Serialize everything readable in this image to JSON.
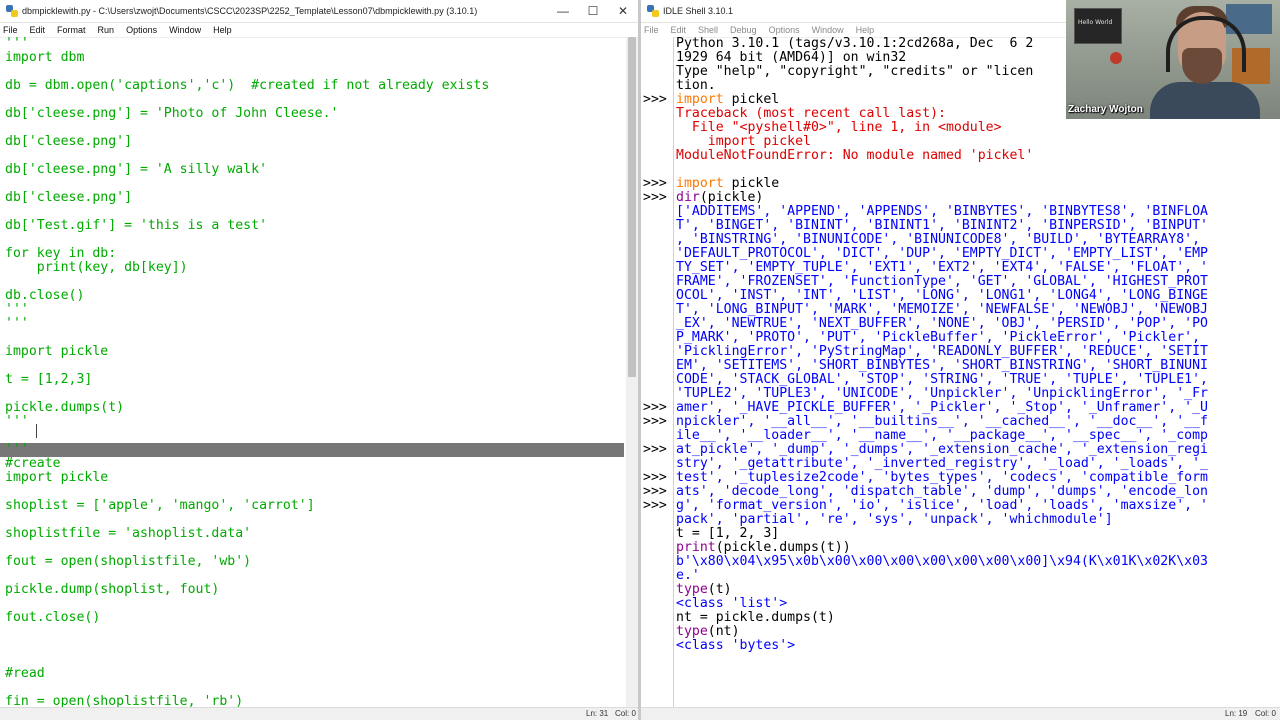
{
  "editor": {
    "title": "dbmpicklewith.py - C:\\Users\\zwojt\\Documents\\CSCC\\2023SP\\2252_Template\\Lesson07\\dbmpicklewith.py (3.10.1)",
    "menu": [
      "File",
      "Edit",
      "Format",
      "Run",
      "Options",
      "Window",
      "Help"
    ],
    "lines": [
      {
        "t": "'''",
        "c": "string"
      },
      {
        "t": "import dbm",
        "c": "string"
      },
      {
        "t": "",
        "c": "string"
      },
      {
        "t": "db = dbm.open('captions','c')  #created if not already exists",
        "c": "string"
      },
      {
        "t": "",
        "c": "string"
      },
      {
        "t": "db['cleese.png'] = 'Photo of John Cleese.'",
        "c": "string"
      },
      {
        "t": "",
        "c": "string"
      },
      {
        "t": "db['cleese.png']",
        "c": "string"
      },
      {
        "t": "",
        "c": "string"
      },
      {
        "t": "db['cleese.png'] = 'A silly walk'",
        "c": "string"
      },
      {
        "t": "",
        "c": "string"
      },
      {
        "t": "db['cleese.png']",
        "c": "string"
      },
      {
        "t": "",
        "c": "string"
      },
      {
        "t": "db['Test.gif'] = 'this is a test'",
        "c": "string"
      },
      {
        "t": "",
        "c": "string"
      },
      {
        "t": "for key in db:",
        "c": "string"
      },
      {
        "t": "    print(key, db[key])",
        "c": "string"
      },
      {
        "t": "",
        "c": "string"
      },
      {
        "t": "db.close()",
        "c": "string"
      },
      {
        "t": "'''",
        "c": "string"
      },
      {
        "t": "'''",
        "c": "string"
      },
      {
        "t": "",
        "c": "string"
      },
      {
        "t": "import pickle",
        "c": "string"
      },
      {
        "t": "",
        "c": "string"
      },
      {
        "t": "t = [1,2,3]",
        "c": "string"
      },
      {
        "t": "",
        "c": "string"
      },
      {
        "t": "pickle.dumps(t)",
        "c": "string"
      },
      {
        "t": "'''",
        "c": "string"
      },
      {
        "t": "",
        "c": "string"
      },
      {
        "t": "'''",
        "c": "string",
        "sel": true
      },
      {
        "t": "#create",
        "c": "string"
      },
      {
        "t": "import pickle",
        "c": "string"
      },
      {
        "t": "",
        "c": "string"
      },
      {
        "t": "shoplist = ['apple', 'mango', 'carrot']",
        "c": "string"
      },
      {
        "t": "",
        "c": "string"
      },
      {
        "t": "shoplistfile = 'ashoplist.data'",
        "c": "string"
      },
      {
        "t": "",
        "c": "string"
      },
      {
        "t": "fout = open(shoplistfile, 'wb')",
        "c": "string"
      },
      {
        "t": "",
        "c": "string"
      },
      {
        "t": "pickle.dump(shoplist, fout)",
        "c": "string"
      },
      {
        "t": "",
        "c": "string"
      },
      {
        "t": "fout.close()",
        "c": "string"
      },
      {
        "t": "",
        "c": "string"
      },
      {
        "t": "",
        "c": "string"
      },
      {
        "t": "",
        "c": "string"
      },
      {
        "t": "#read",
        "c": "string"
      },
      {
        "t": "",
        "c": "string"
      },
      {
        "t": "fin = open(shoplistfile, 'rb')",
        "c": "string"
      }
    ],
    "status_line": "Ln: 31",
    "status_col": "Col: 0"
  },
  "shell": {
    "title": "IDLE Shell 3.10.1",
    "menu": [
      "File",
      "Edit",
      "Shell",
      "Debug",
      "Options",
      "Window",
      "Help"
    ],
    "prompt": ">>>",
    "prompt_rows": [
      4,
      10,
      11,
      26,
      27,
      29,
      31,
      32,
      33
    ],
    "lines": [
      {
        "t": "Python 3.10.1 (tags/v3.10.1:2cd268a, Dec  6 2",
        "c": "normal"
      },
      {
        "t": "1929 64 bit (AMD64)] on win32",
        "c": "normal"
      },
      {
        "t": "Type \"help\", \"copyright\", \"credits\" or \"licen",
        "c": "normal"
      },
      {
        "t": "tion.",
        "c": "normal"
      },
      {
        "t": "import pickel",
        "c": "normal",
        "kw": "import"
      },
      {
        "t": "Traceback (most recent call last):",
        "c": "error"
      },
      {
        "t": "  File \"<pyshell#0>\", line 1, in <module>",
        "c": "error"
      },
      {
        "t": "    import pickel",
        "c": "error"
      },
      {
        "t": "ModuleNotFoundError: No module named 'pickel'",
        "c": "error"
      },
      {
        "t": "",
        "c": "normal"
      },
      {
        "t": "import pickle",
        "c": "normal",
        "kw": "import"
      },
      {
        "t": "dir(pickle)",
        "c": "normal",
        "bi": "dir"
      },
      {
        "t": "['ADDITEMS', 'APPEND', 'APPENDS', 'BINBYTES', 'BINBYTES8', 'BINFLOA",
        "c": "output"
      },
      {
        "t": "T', 'BINGET', 'BININT', 'BININT1', 'BININT2', 'BINPERSID', 'BINPUT'",
        "c": "output"
      },
      {
        "t": ", 'BINSTRING', 'BINUNICODE', 'BINUNICODE8', 'BUILD', 'BYTEARRAY8',",
        "c": "output"
      },
      {
        "t": "'DEFAULT_PROTOCOL', 'DICT', 'DUP', 'EMPTY_DICT', 'EMPTY_LIST', 'EMP",
        "c": "output"
      },
      {
        "t": "TY_SET', 'EMPTY_TUPLE', 'EXT1', 'EXT2', 'EXT4', 'FALSE', 'FLOAT', '",
        "c": "output"
      },
      {
        "t": "FRAME', 'FROZENSET', 'FunctionType', 'GET', 'GLOBAL', 'HIGHEST_PROT",
        "c": "output"
      },
      {
        "t": "OCOL', 'INST', 'INT', 'LIST', 'LONG', 'LONG1', 'LONG4', 'LONG_BINGE",
        "c": "output"
      },
      {
        "t": "T', 'LONG_BINPUT', 'MARK', 'MEMOIZE', 'NEWFALSE', 'NEWOBJ', 'NEWOBJ",
        "c": "output"
      },
      {
        "t": "_EX', 'NEWTRUE', 'NEXT_BUFFER', 'NONE', 'OBJ', 'PERSID', 'POP', 'PO",
        "c": "output"
      },
      {
        "t": "P_MARK', 'PROTO', 'PUT', 'PickleBuffer', 'PickleError', 'Pickler',",
        "c": "output"
      },
      {
        "t": "'PicklingError', 'PyStringMap', 'READONLY_BUFFER', 'REDUCE', 'SETIT",
        "c": "output"
      },
      {
        "t": "EM', 'SETITEMS', 'SHORT_BINBYTES', 'SHORT_BINSTRING', 'SHORT_BINUNI",
        "c": "output"
      },
      {
        "t": "CODE', 'STACK_GLOBAL', 'STOP', 'STRING', 'TRUE', 'TUPLE', 'TUPLE1',",
        "c": "output"
      },
      {
        "t": "'TUPLE2', 'TUPLE3', 'UNICODE', 'Unpickler', 'UnpicklingError', '_Fr",
        "c": "output"
      },
      {
        "t": "amer', '_HAVE_PICKLE_BUFFER', '_Pickler', '_Stop', '_Unframer', '_U",
        "c": "output"
      },
      {
        "t": "npickler', '__all__', '__builtins__', '__cached__', '__doc__', '__f",
        "c": "output"
      },
      {
        "t": "ile__', '__loader__', '__name__', '__package__', '__spec__', '_comp",
        "c": "output"
      },
      {
        "t": "at_pickle', '_dump', '_dumps', '_extension_cache', '_extension_regi",
        "c": "output"
      },
      {
        "t": "stry', '_getattribute', '_inverted_registry', '_load', '_loads', '_",
        "c": "output"
      },
      {
        "t": "test', '_tuplesize2code', 'bytes_types', 'codecs', 'compatible_form",
        "c": "output"
      },
      {
        "t": "ats', 'decode_long', 'dispatch_table', 'dump', 'dumps', 'encode_lon",
        "c": "output"
      },
      {
        "t": "g', 'format_version', 'io', 'islice', 'load', 'loads', 'maxsize', '",
        "c": "output"
      },
      {
        "t": "pack', 'partial', 're', 'sys', 'unpack', 'whichmodule']",
        "c": "output"
      },
      {
        "t": "t = [1, 2, 3]",
        "c": "normal"
      },
      {
        "t": "print(pickle.dumps(t))",
        "c": "normal",
        "bi": "print"
      },
      {
        "t": "b'\\x80\\x04\\x95\\x0b\\x00\\x00\\x00\\x00\\x00\\x00\\x00]\\x94(K\\x01K\\x02K\\x03",
        "c": "output"
      },
      {
        "t": "e.'",
        "c": "output"
      },
      {
        "t": "type(t)",
        "c": "normal",
        "bi": "type"
      },
      {
        "t": "<class 'list'>",
        "c": "output"
      },
      {
        "t": "nt = pickle.dumps(t)",
        "c": "normal"
      },
      {
        "t": "type(nt)",
        "c": "normal",
        "bi": "type"
      },
      {
        "t": "<class 'bytes'>",
        "c": "output"
      },
      {
        "t": "",
        "c": "normal"
      }
    ],
    "status_line": "Ln: 19",
    "status_col": "Col: 0"
  },
  "webcam": {
    "name": "Zachary Wojton",
    "shelf_text": "Hello World"
  },
  "colors": {
    "string": "#00aa00",
    "keyword": "#ff7700",
    "builtin": "#900090",
    "error": "#dd0000",
    "output": "#0000ff",
    "selection": "#777777"
  }
}
